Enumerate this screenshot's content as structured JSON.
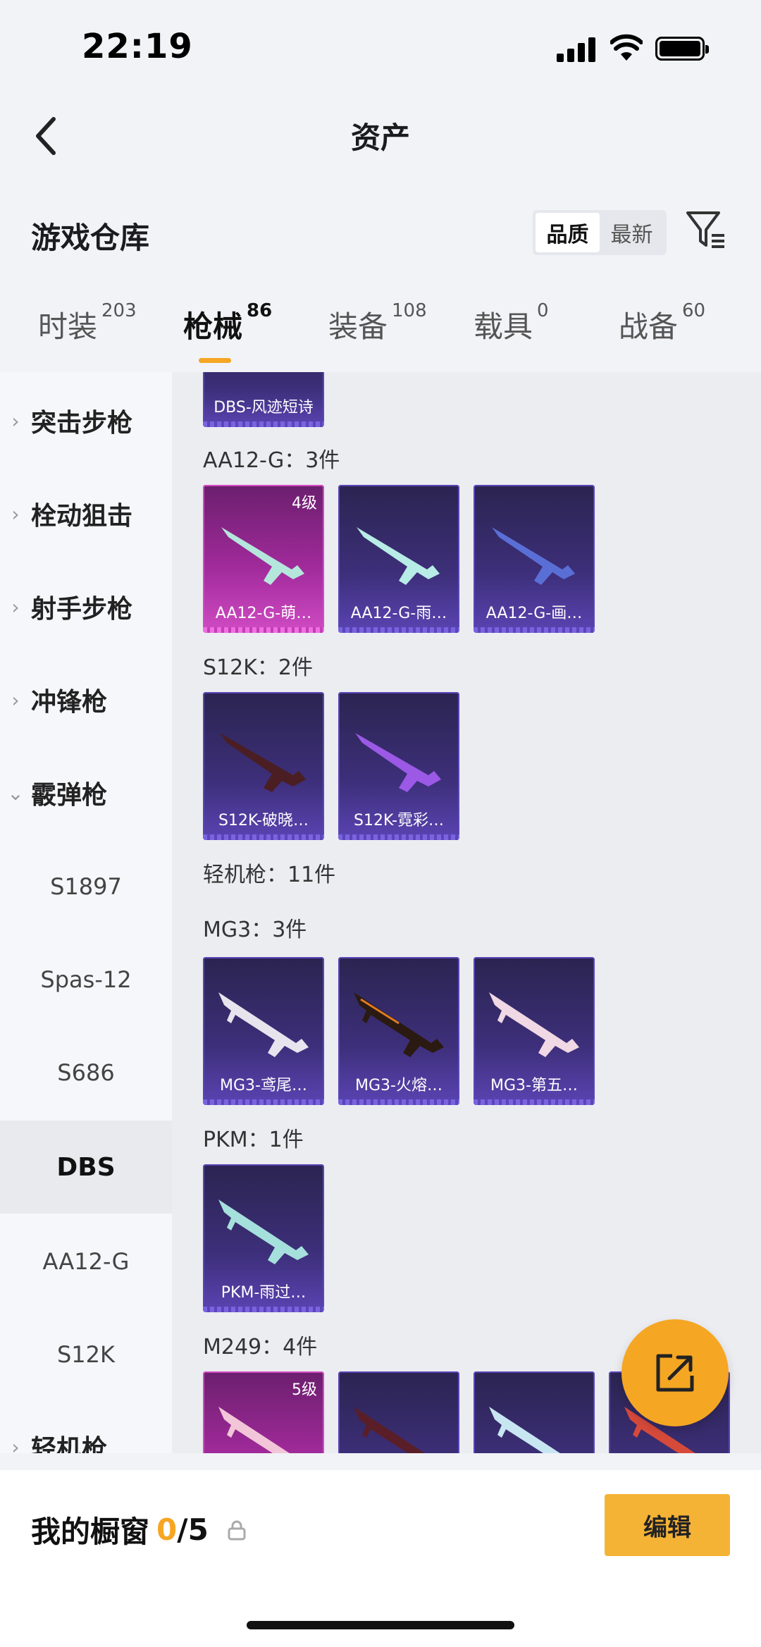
{
  "status_bar": {
    "time": "22:19"
  },
  "nav": {
    "title": "资产"
  },
  "header": {
    "title": "游戏仓库",
    "sort_options": [
      "品质",
      "最新"
    ]
  },
  "tabs": [
    {
      "label": "时装",
      "count": "203"
    },
    {
      "label": "枪械",
      "count": "86"
    },
    {
      "label": "装备",
      "count": "108"
    },
    {
      "label": "载具",
      "count": "0"
    },
    {
      "label": "战备",
      "count": "60"
    }
  ],
  "sidebar": {
    "categories": [
      "突击步枪",
      "栓动狙击",
      "射手步枪",
      "冲锋枪",
      "霰弹枪"
    ],
    "subitems": [
      "S1897",
      "Spas-12",
      "S686",
      "DBS",
      "AA12-G",
      "S12K"
    ],
    "bottom_category": "轻机枪"
  },
  "content": {
    "partial_card": "DBS-风迹短诗",
    "groups": [
      {
        "label": "AA12-G：3件",
        "cards": [
          "AA12-G-萌…",
          "AA12-G-雨…",
          "AA12-G-画…"
        ],
        "level": "4级"
      },
      {
        "label": "S12K：2件",
        "cards": [
          "S12K-破晓…",
          "S12K-霓彩…"
        ]
      },
      {
        "label": "轻机枪：11件"
      },
      {
        "label": "MG3：3件",
        "cards": [
          "MG3-鸢尾…",
          "MG3-火熔…",
          "MG3-第五…"
        ]
      },
      {
        "label": "PKM：1件",
        "cards": [
          "PKM-雨过…"
        ]
      },
      {
        "label": "M249：4件",
        "level": "5级"
      }
    ]
  },
  "bottom_bar": {
    "label": "我的橱窗",
    "current": "0",
    "total": "/5",
    "edit": "编辑"
  },
  "colors": {
    "accent": "#f5a623",
    "card_purple": "#3d2f7a",
    "card_pink": "#a02a9a"
  }
}
